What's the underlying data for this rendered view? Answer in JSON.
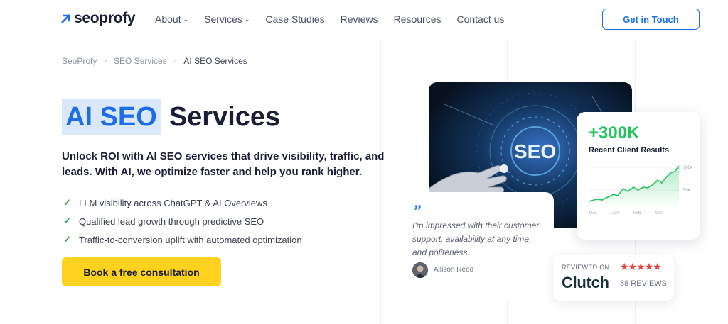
{
  "header": {
    "logo_text": "seoprofy",
    "nav": [
      {
        "label": "About",
        "has_dropdown": true
      },
      {
        "label": "Services",
        "has_dropdown": true
      },
      {
        "label": "Case Studies",
        "has_dropdown": false
      },
      {
        "label": "Reviews",
        "has_dropdown": false
      },
      {
        "label": "Resources",
        "has_dropdown": false
      },
      {
        "label": "Contact us",
        "has_dropdown": false
      }
    ],
    "cta_label": "Get in Touch"
  },
  "breadcrumb": {
    "items": [
      "SeoProfy",
      "SEO Services",
      "AI SEO Services"
    ]
  },
  "hero": {
    "title_highlight": "AI SEO",
    "title_rest": "Services",
    "subtitle": "Unlock ROI with AI SEO services that drive visibility, traffic, and leads. With AI, we optimize faster and help you rank higher.",
    "bullets": [
      "LLM visibility across ChatGPT & AI Overviews",
      "Qualified lead growth through predictive SEO",
      "Traffic-to-conversion uplift with automated optimization"
    ],
    "cta_label": "Book a free consultation"
  },
  "photo": {
    "overlay_text": "SEO"
  },
  "stats": {
    "value": "+300K",
    "label": "Recent Client Results",
    "chart_y_labels": [
      "100k",
      "50k"
    ],
    "chart_x_labels": [
      "Dec",
      "Jan",
      "Feb",
      "Mar"
    ]
  },
  "testimonial": {
    "quote_mark": "”",
    "text": "I'm impressed with their customer support, availability at any time, and politeness.",
    "author": "Allison Reed"
  },
  "clutch": {
    "reviewed_on": "REVIEWED ON",
    "logo": "Clutch",
    "stars": "★★★★★",
    "reviews_count": "88 REVIEWS"
  },
  "colors": {
    "accent_blue": "#1b6ee8",
    "cta_yellow": "#ffd21f",
    "success_green": "#22c55e",
    "clutch_red": "#e8453c"
  }
}
